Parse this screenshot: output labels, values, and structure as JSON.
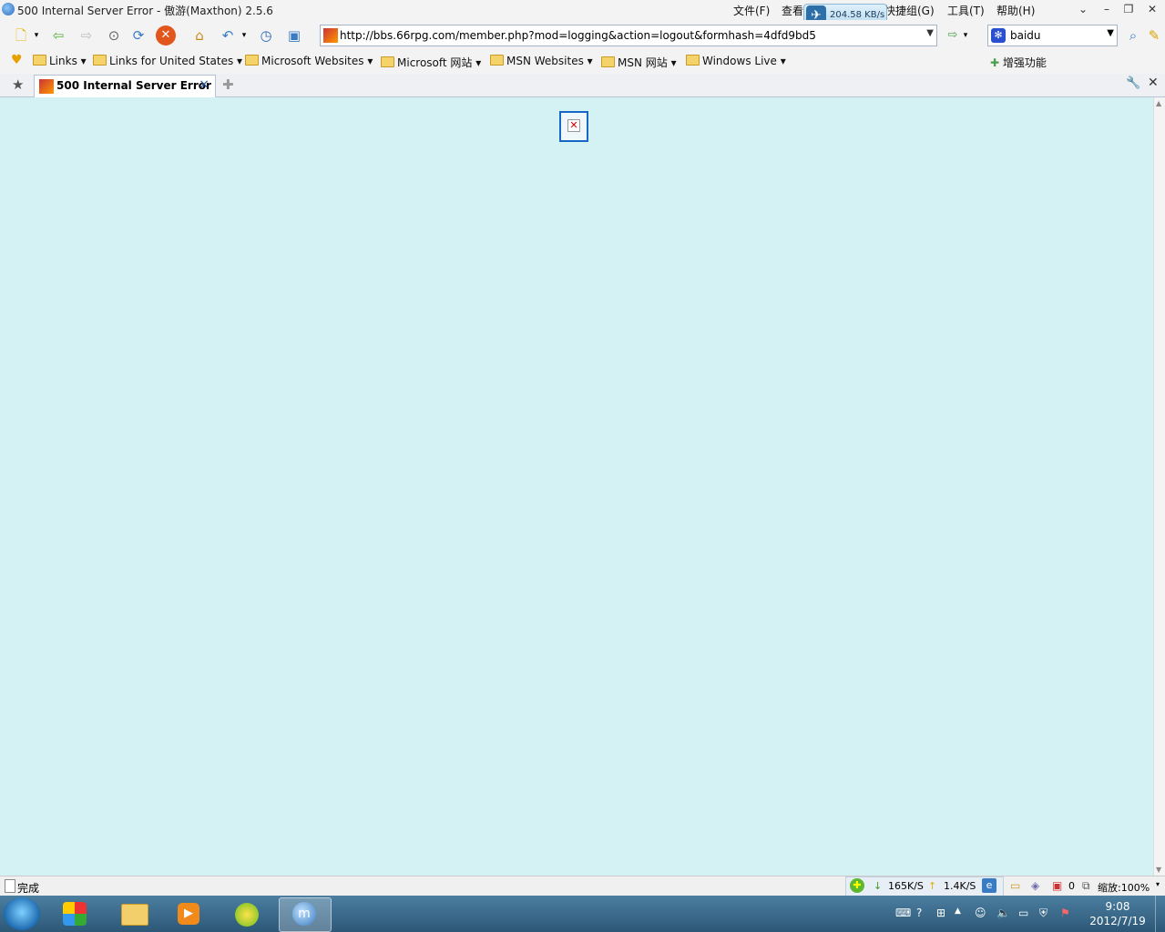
{
  "window": {
    "title": "500 Internal Server Error - 傲游(Maxthon) 2.5.6",
    "menu": [
      "文件(F)",
      "查看",
      "快捷组(G)",
      "工具(T)",
      "帮助(H)"
    ]
  },
  "speed_widget": {
    "value": "204.58 KB/s"
  },
  "address_bar": {
    "url": "http://bbs.66rpg.com/member.php?mod=logging&action=logout&formhash=4dfd9bd5"
  },
  "search_box": {
    "engine": "baidu"
  },
  "links_bar": {
    "items": [
      "Links",
      "Links for United States",
      "Microsoft Websites",
      "Microsoft 网站",
      "MSN Websites",
      "MSN 网站",
      "Windows Live"
    ],
    "addons_label": "增强功能"
  },
  "tab": {
    "title": "500 Internal Server Error"
  },
  "status_bar": {
    "status": "完成",
    "download_speed": "165K/S",
    "upload_speed": "1.4K/S",
    "count": "0",
    "zoom": "缩放:100%"
  },
  "taskbar": {
    "time": "9:08",
    "date": "2012/7/19"
  },
  "colors": {
    "content_bg": "#d4f2f4",
    "tab_close": "#2050a0"
  }
}
